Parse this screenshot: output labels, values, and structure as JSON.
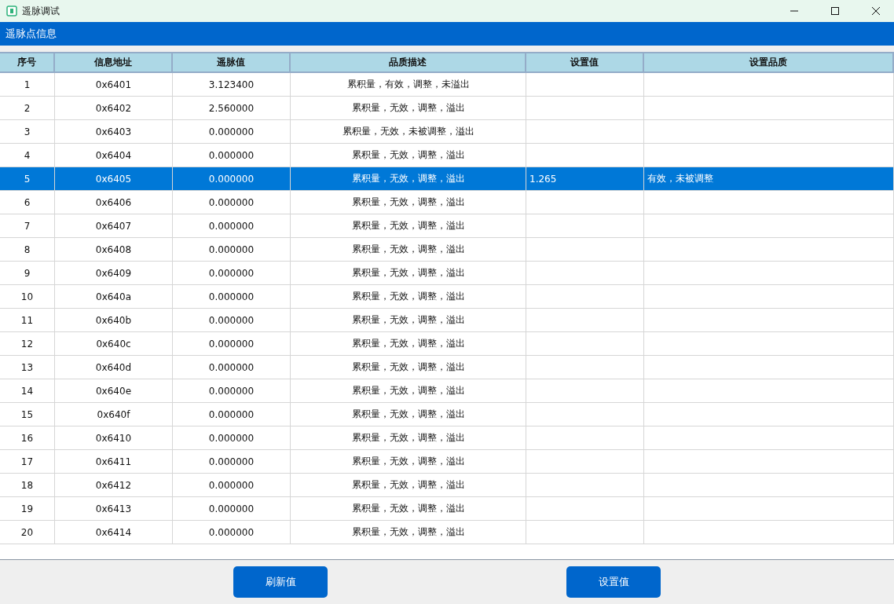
{
  "window": {
    "title": "遥脉调试"
  },
  "section": {
    "title": "遥脉点信息"
  },
  "table": {
    "columns": [
      "序号",
      "信息地址",
      "遥脉值",
      "品质描述",
      "设置值",
      "设置品质"
    ],
    "rows": [
      {
        "cells": [
          "1",
          "0x6401",
          "3.123400",
          "累积量，有效，调整，未溢出"
        ],
        "selected": false
      },
      {
        "cells": [
          "2",
          "0x6402",
          "2.560000",
          "累积量，无效，调整，溢出"
        ],
        "selected": false
      },
      {
        "cells": [
          "3",
          "0x6403",
          "0.000000",
          "累积量，无效，未被调整，溢出"
        ],
        "selected": false
      },
      {
        "cells": [
          "4",
          "0x6404",
          "0.000000",
          "累积量，无效，调整，溢出"
        ],
        "selected": false
      },
      {
        "cells": [
          "5",
          "0x6405",
          "0.000000",
          "累积量，无效，调整，溢出",
          "1.265",
          "有效，未被调整"
        ],
        "selected": true
      },
      {
        "cells": [
          "6",
          "0x6406",
          "0.000000",
          "累积量，无效，调整，溢出"
        ],
        "selected": false
      },
      {
        "cells": [
          "7",
          "0x6407",
          "0.000000",
          "累积量，无效，调整，溢出"
        ],
        "selected": false
      },
      {
        "cells": [
          "8",
          "0x6408",
          "0.000000",
          "累积量，无效，调整，溢出"
        ],
        "selected": false
      },
      {
        "cells": [
          "9",
          "0x6409",
          "0.000000",
          "累积量，无效，调整，溢出"
        ],
        "selected": false
      },
      {
        "cells": [
          "10",
          "0x640a",
          "0.000000",
          "累积量，无效，调整，溢出"
        ],
        "selected": false
      },
      {
        "cells": [
          "11",
          "0x640b",
          "0.000000",
          "累积量，无效，调整，溢出"
        ],
        "selected": false
      },
      {
        "cells": [
          "12",
          "0x640c",
          "0.000000",
          "累积量，无效，调整，溢出"
        ],
        "selected": false
      },
      {
        "cells": [
          "13",
          "0x640d",
          "0.000000",
          "累积量，无效，调整，溢出"
        ],
        "selected": false
      },
      {
        "cells": [
          "14",
          "0x640e",
          "0.000000",
          "累积量，无效，调整，溢出"
        ],
        "selected": false
      },
      {
        "cells": [
          "15",
          "0x640f",
          "0.000000",
          "累积量，无效，调整，溢出"
        ],
        "selected": false
      },
      {
        "cells": [
          "16",
          "0x6410",
          "0.000000",
          "累积量，无效，调整，溢出"
        ],
        "selected": false
      },
      {
        "cells": [
          "17",
          "0x6411",
          "0.000000",
          "累积量，无效，调整，溢出"
        ],
        "selected": false
      },
      {
        "cells": [
          "18",
          "0x6412",
          "0.000000",
          "累积量，无效，调整，溢出"
        ],
        "selected": false
      },
      {
        "cells": [
          "19",
          "0x6413",
          "0.000000",
          "累积量，无效，调整，溢出"
        ],
        "selected": false
      },
      {
        "cells": [
          "20",
          "0x6414",
          "0.000000",
          "累积量，无效，调整，溢出"
        ],
        "selected": false
      }
    ]
  },
  "buttons": [
    "刷新值",
    "设置值"
  ]
}
